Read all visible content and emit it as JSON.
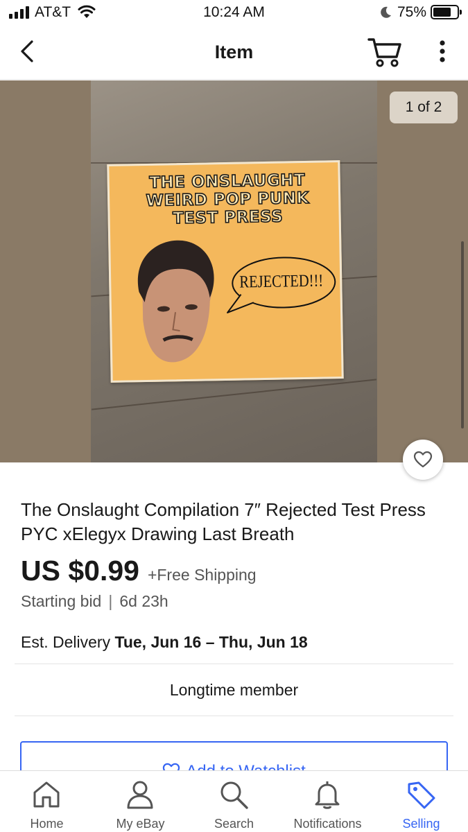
{
  "status_bar": {
    "carrier": "AT&T",
    "time": "10:24 AM",
    "battery": "75%",
    "battery_level": 0.75
  },
  "nav": {
    "title": "Item",
    "back_icon": "chevron-left-icon",
    "cart_icon": "cart-icon",
    "more_icon": "more-vertical-icon"
  },
  "gallery": {
    "counter": "1 of 2",
    "photo_text": {
      "sleeve_title": "THE ONSLAUGHT WEIRD POP PUNK TEST PRESS",
      "speech_bubble": "REJECTED!!!"
    }
  },
  "item": {
    "title": "The Onslaught Compilation 7″ Rejected Test Press PYC xElegyx Drawing Last Breath",
    "price": "US $0.99",
    "shipping": "+Free Shipping",
    "bid_type": "Starting bid",
    "separator": "|",
    "time_left": "6d 23h",
    "delivery_label": "Est. Delivery",
    "delivery_dates": "Tue, Jun 16 – Thu, Jun 18",
    "seller_badge": "Longtime member",
    "watchlist_button": "Add to Watchlist"
  },
  "tabs": [
    {
      "label": "Home",
      "icon": "home-icon"
    },
    {
      "label": "My eBay",
      "icon": "person-icon"
    },
    {
      "label": "Search",
      "icon": "search-icon"
    },
    {
      "label": "Notifications",
      "icon": "bell-icon"
    },
    {
      "label": "Selling",
      "icon": "tag-icon",
      "active": true
    }
  ],
  "colors": {
    "accent": "#3665f3",
    "text": "#191919",
    "secondary_text": "#555555"
  }
}
